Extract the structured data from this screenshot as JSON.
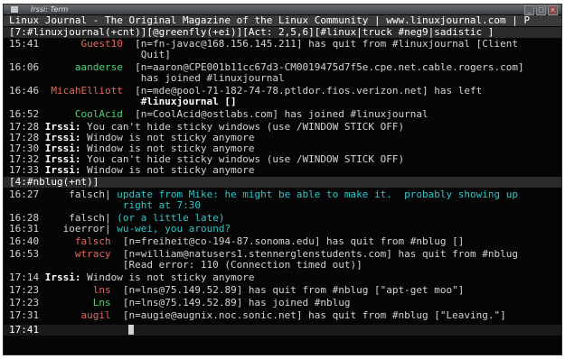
{
  "window": {
    "title": "Irssi: Term",
    "controls": [
      "_",
      "▢",
      "×"
    ]
  },
  "topic_bar": "Linux Journal - The Original Magazine of the Linux Community | www.linuxjournal.com | P",
  "status_bar": "[7:#linuxjournal(+cnt)][@greenfly(+ei)][Act: 2,5,6][#linux|truck #neg9|sadistic ]",
  "channel_bar": "[4:#nblug(+nt)]",
  "input_line": "17:41",
  "lines": [
    {
      "time": "15:41",
      "nick": "Guest10",
      "text": "[n=fn-javac@168.156.145.211] has quit from #linuxjournal [Client"
    },
    {
      "time": "",
      "nick": "",
      "text": "Quit]"
    },
    {
      "time": "16:06",
      "nick": "aanderse",
      "text": "[n=aaron@CPE001b11cc67d3-CM0019475d7f5e.cpe.net.cable.rogers.com]"
    },
    {
      "time": "",
      "nick": "",
      "text": "has joined #linuxjournal"
    },
    {
      "time": "16:46",
      "nick": "MicahElliott",
      "text": "[n=mde@pool-71-182-74-78.ptldor.fios.verizon.net] has left"
    },
    {
      "time": "",
      "nick": "",
      "text": "#linuxjournal []"
    },
    {
      "time": "16:52",
      "nick": "CoolAcid",
      "text": "[n=CoolAcid@ostlabs.com] has joined #linuxjournal"
    },
    {
      "time": "17:28",
      "nick": "Irssi:",
      "text": "You can't hide sticky windows (use /WINDOW STICK OFF)"
    },
    {
      "time": "17:28",
      "nick": "Irssi:",
      "text": "Window is not sticky anymore"
    },
    {
      "time": "17:30",
      "nick": "Irssi:",
      "text": "Window is not sticky anymore"
    },
    {
      "time": "17:32",
      "nick": "Irssi:",
      "text": "You can't hide sticky windows (use /WINDOW STICK OFF)"
    },
    {
      "time": "17:33",
      "nick": "Irssi:",
      "text": "Window is not sticky anymore"
    },
    {
      "time": "16:27",
      "nick": "falsch|",
      "text": "update from Mike: he might be able to make it.  probably showing up"
    },
    {
      "time": "",
      "nick": "",
      "text": "right at 7:30"
    },
    {
      "time": "16:28",
      "nick": "falsch|",
      "text": "(or a little late)"
    },
    {
      "time": "16:31",
      "nick": "ioerror|",
      "text": "wu-wei, you around?"
    },
    {
      "time": "16:40",
      "nick": "falsch",
      "text": "[n=freiheit@co-194-87.sonoma.edu] has quit from #nblug []"
    },
    {
      "time": "16:53",
      "nick": "wtracy",
      "text": "[n=william@natusers1.stennerglenstudents.com] has quit from #nblug"
    },
    {
      "time": "",
      "nick": "",
      "text": "[Read error: 110 (Connection timed out)]"
    },
    {
      "time": "17:14",
      "nick": "Irssi:",
      "text": "Window is not sticky anymore"
    },
    {
      "time": "17:23",
      "nick": "lns",
      "text": "[n=lns@75.149.52.89] has quit from #nblug [\"apt-get moo\"]"
    },
    {
      "time": "17:23",
      "nick": "Lns",
      "text": "[n=lns@75.149.52.89] has joined #nblug"
    },
    {
      "time": "17:31",
      "nick": "augil",
      "text": "[n=augie@augnix.noc.sonic.net] has quit from #nblug [\"Leaving.\"]"
    }
  ]
}
